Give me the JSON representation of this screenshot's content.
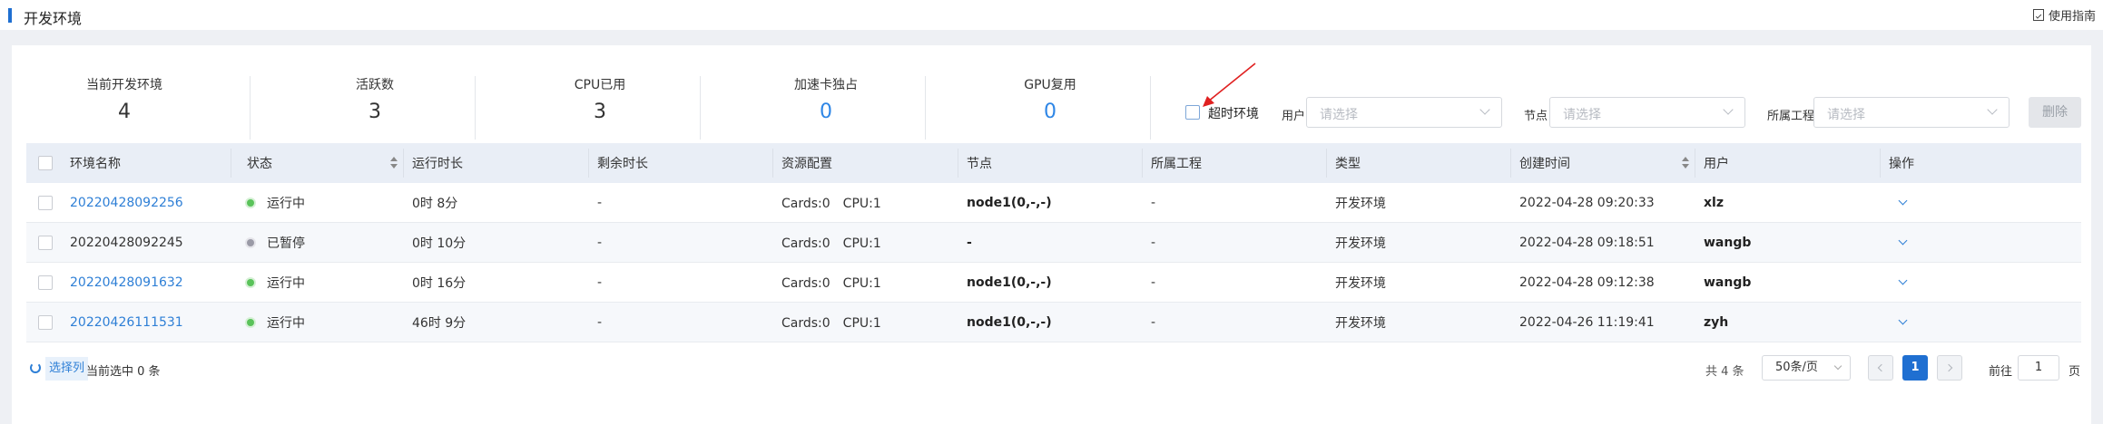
{
  "header": {
    "title": "开发环境",
    "guide_label": "使用指南"
  },
  "stats": [
    {
      "label": "当前开发环境",
      "value": "4",
      "highlight": false
    },
    {
      "label": "活跃数",
      "value": "3",
      "highlight": false
    },
    {
      "label": "CPU已用",
      "value": "3",
      "highlight": false
    },
    {
      "label": "加速卡独占",
      "value": "0",
      "highlight": true
    },
    {
      "label": "GPU复用",
      "value": "0",
      "highlight": true
    }
  ],
  "filters": {
    "timeout_label": "超时环境",
    "timeout_checked": false,
    "user_label": "用户",
    "user_placeholder": "请选择",
    "node_label": "节点",
    "node_placeholder": "请选择",
    "project_label": "所属工程",
    "project_placeholder": "请选择",
    "delete_label": "删除"
  },
  "table": {
    "columns": [
      "环境名称",
      "状态",
      "运行时长",
      "剩余时长",
      "资源配置",
      "节点",
      "所属工程",
      "类型",
      "创建时间",
      "用户",
      "操作"
    ],
    "rows": [
      {
        "name": "20220428092256",
        "name_link": true,
        "status": "运行中",
        "status_color": "#5ac35a",
        "run": "0时 8分",
        "remain": "-",
        "res": "Cards:0　CPU:1",
        "node": "node1(0,-,-)",
        "project": "-",
        "type": "开发环境",
        "created": "2022-04-28 09:20:33",
        "user": "xlz"
      },
      {
        "name": "20220428092245",
        "name_link": false,
        "status": "已暂停",
        "status_color": "#9a9aa6",
        "run": "0时 10分",
        "remain": "-",
        "res": "Cards:0　CPU:1",
        "node": "-",
        "project": "-",
        "type": "开发环境",
        "created": "2022-04-28 09:18:51",
        "user": "wangb"
      },
      {
        "name": "20220428091632",
        "name_link": true,
        "status": "运行中",
        "status_color": "#5ac35a",
        "run": "0时 16分",
        "remain": "-",
        "res": "Cards:0　CPU:1",
        "node": "node1(0,-,-)",
        "project": "-",
        "type": "开发环境",
        "created": "2022-04-28 09:12:38",
        "user": "wangb"
      },
      {
        "name": "20220426111531",
        "name_link": true,
        "status": "运行中",
        "status_color": "#5ac35a",
        "run": "46时 9分",
        "remain": "-",
        "res": "Cards:0　CPU:1",
        "node": "node1(0,-,-)",
        "project": "-",
        "type": "开发环境",
        "created": "2022-04-26 11:19:41",
        "user": "zyh"
      }
    ]
  },
  "footer": {
    "select_columns_label": "选择列",
    "selected_count_label": "当前选中 0 条",
    "total_label": "共 4 条",
    "page_size": "50条/页",
    "current_page": "1",
    "goto_prefix": "前往",
    "goto_value": "1",
    "goto_suffix": "页"
  },
  "colors": {
    "accent": "#1f6fd1",
    "link": "#2e7fd6",
    "running": "#5ac35a",
    "paused": "#9a9aa6",
    "annotation_arrow": "#e02020"
  }
}
